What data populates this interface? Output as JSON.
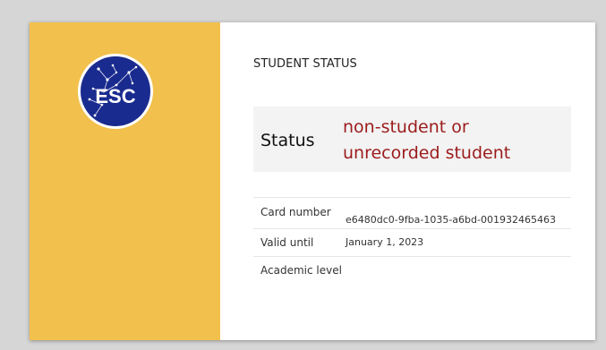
{
  "logo": {
    "text": "ESC"
  },
  "card": {
    "title": "STUDENT STATUS"
  },
  "status": {
    "label": "Status",
    "value": "non-student or unrecorded student",
    "color": "#9b1c1c"
  },
  "details": [
    {
      "label": "Card number",
      "value": "e6480dc0-9fba-1035-a6bd-001932465463"
    },
    {
      "label": "Valid until",
      "value": "January 1, 2023"
    },
    {
      "label": "Academic level",
      "value": ""
    }
  ],
  "colors": {
    "sidebar": "#f2c04c",
    "logo_bg": "#1a2b8f",
    "background": "#d6d6d6"
  }
}
